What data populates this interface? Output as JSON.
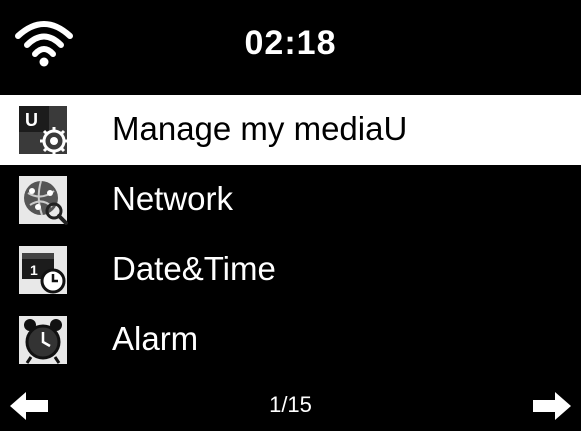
{
  "status": {
    "time": "02:18",
    "wifi_icon": "wifi-icon"
  },
  "menu": {
    "items": [
      {
        "label": "Manage my mediaU",
        "icon": "media-settings-icon",
        "selected": true
      },
      {
        "label": "Network",
        "icon": "network-globe-icon",
        "selected": false
      },
      {
        "label": "Date&Time",
        "icon": "calendar-clock-icon",
        "selected": false
      },
      {
        "label": "Alarm",
        "icon": "alarm-clock-icon",
        "selected": false
      }
    ]
  },
  "footer": {
    "page_indicator": "1/15",
    "prev_icon": "arrow-left-icon",
    "next_icon": "arrow-right-icon"
  },
  "colors": {
    "background": "#000000",
    "selected_bg": "#ffffff",
    "text": "#ffffff",
    "selected_text": "#000000"
  }
}
